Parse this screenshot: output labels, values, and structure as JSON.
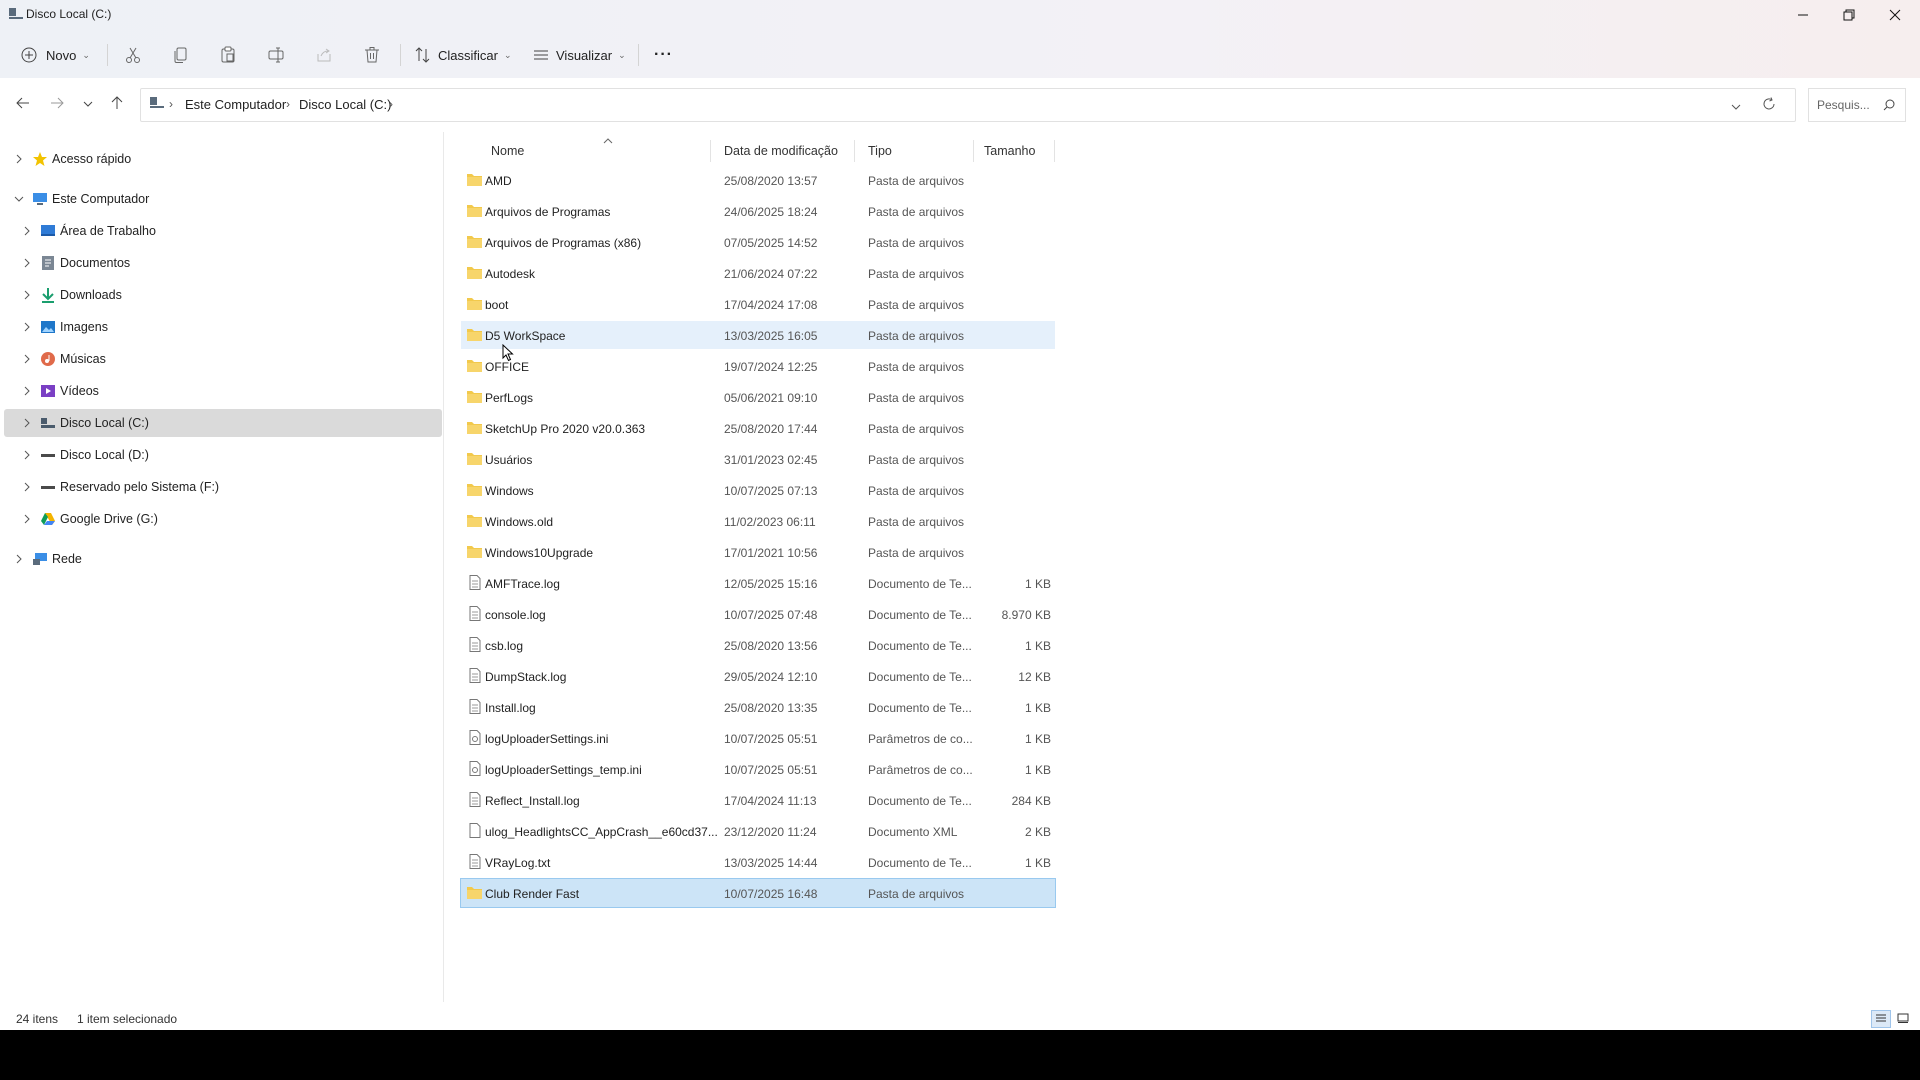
{
  "window": {
    "title": "Disco Local (C:)",
    "minimize": "—",
    "maximize": "❐",
    "close": "✕"
  },
  "toolbar": {
    "new_label": "Novo",
    "sort_label": "Classificar",
    "view_label": "Visualizar",
    "more_label": "···"
  },
  "address": {
    "crumbs": [
      "Este Computador",
      "Disco Local (C:)"
    ],
    "search_placeholder": "Pesquis..."
  },
  "sidebar": {
    "items": [
      {
        "label": "Acesso rápido",
        "icon": "star-icon"
      },
      {
        "label": "Este Computador",
        "icon": "computer-icon"
      },
      {
        "label": "Área de Trabalho",
        "icon": "desktop-icon"
      },
      {
        "label": "Documentos",
        "icon": "documents-icon"
      },
      {
        "label": "Downloads",
        "icon": "download-icon"
      },
      {
        "label": "Imagens",
        "icon": "pictures-icon"
      },
      {
        "label": "Músicas",
        "icon": "music-icon"
      },
      {
        "label": "Vídeos",
        "icon": "videos-icon"
      },
      {
        "label": "Disco Local (C:)",
        "icon": "windows-drive-icon"
      },
      {
        "label": "Disco Local (D:)",
        "icon": "drive-icon"
      },
      {
        "label": "Reservado pelo Sistema (F:)",
        "icon": "drive-icon"
      },
      {
        "label": "Google Drive (G:)",
        "icon": "google-drive-icon"
      },
      {
        "label": "Rede",
        "icon": "network-icon"
      }
    ]
  },
  "columns": {
    "name": "Nome",
    "date": "Data de modificação",
    "type": "Tipo",
    "size": "Tamanho"
  },
  "files": [
    {
      "name": "AMD",
      "date": "25/08/2020 13:57",
      "type": "Pasta de arquivos",
      "size": "",
      "kind": "folder"
    },
    {
      "name": "Arquivos de Programas",
      "date": "24/06/2025 18:24",
      "type": "Pasta de arquivos",
      "size": "",
      "kind": "folder"
    },
    {
      "name": "Arquivos de Programas (x86)",
      "date": "07/05/2025 14:52",
      "type": "Pasta de arquivos",
      "size": "",
      "kind": "folder"
    },
    {
      "name": "Autodesk",
      "date": "21/06/2024 07:22",
      "type": "Pasta de arquivos",
      "size": "",
      "kind": "folder"
    },
    {
      "name": "boot",
      "date": "17/04/2024 17:08",
      "type": "Pasta de arquivos",
      "size": "",
      "kind": "folder"
    },
    {
      "name": "D5 WorkSpace",
      "date": "13/03/2025 16:05",
      "type": "Pasta de arquivos",
      "size": "",
      "kind": "folder"
    },
    {
      "name": "OFFICE",
      "date": "19/07/2024 12:25",
      "type": "Pasta de arquivos",
      "size": "",
      "kind": "folder"
    },
    {
      "name": "PerfLogs",
      "date": "05/06/2021 09:10",
      "type": "Pasta de arquivos",
      "size": "",
      "kind": "folder"
    },
    {
      "name": "SketchUp Pro 2020 v20.0.363",
      "date": "25/08/2020 17:44",
      "type": "Pasta de arquivos",
      "size": "",
      "kind": "folder"
    },
    {
      "name": "Usuários",
      "date": "31/01/2023 02:45",
      "type": "Pasta de arquivos",
      "size": "",
      "kind": "folder"
    },
    {
      "name": "Windows",
      "date": "10/07/2025 07:13",
      "type": "Pasta de arquivos",
      "size": "",
      "kind": "folder"
    },
    {
      "name": "Windows.old",
      "date": "11/02/2023 06:11",
      "type": "Pasta de arquivos",
      "size": "",
      "kind": "folder"
    },
    {
      "name": "Windows10Upgrade",
      "date": "17/01/2021 10:56",
      "type": "Pasta de arquivos",
      "size": "",
      "kind": "folder"
    },
    {
      "name": "AMFTrace.log",
      "date": "12/05/2025 15:16",
      "type": "Documento de Te...",
      "size": "1 KB",
      "kind": "text"
    },
    {
      "name": "console.log",
      "date": "10/07/2025 07:48",
      "type": "Documento de Te...",
      "size": "8.970 KB",
      "kind": "text"
    },
    {
      "name": "csb.log",
      "date": "25/08/2020 13:56",
      "type": "Documento de Te...",
      "size": "1 KB",
      "kind": "text"
    },
    {
      "name": "DumpStack.log",
      "date": "29/05/2024 12:10",
      "type": "Documento de Te...",
      "size": "12 KB",
      "kind": "text"
    },
    {
      "name": "Install.log",
      "date": "25/08/2020 13:35",
      "type": "Documento de Te...",
      "size": "1 KB",
      "kind": "text"
    },
    {
      "name": "logUploaderSettings.ini",
      "date": "10/07/2025 05:51",
      "type": "Parâmetros de co...",
      "size": "1 KB",
      "kind": "ini"
    },
    {
      "name": "logUploaderSettings_temp.ini",
      "date": "10/07/2025 05:51",
      "type": "Parâmetros de co...",
      "size": "1 KB",
      "kind": "ini"
    },
    {
      "name": "Reflect_Install.log",
      "date": "17/04/2024 11:13",
      "type": "Documento de Te...",
      "size": "284 KB",
      "kind": "text"
    },
    {
      "name": "ulog_HeadlightsCC_AppCrash__e60cd37...",
      "date": "23/12/2020 11:24",
      "type": "Documento XML",
      "size": "2 KB",
      "kind": "xml"
    },
    {
      "name": "VRayLog.txt",
      "date": "13/03/2025 14:44",
      "type": "Documento de Te...",
      "size": "1 KB",
      "kind": "text"
    },
    {
      "name": "Club Render Fast",
      "date": "10/07/2025 16:48",
      "type": "Pasta de arquivos",
      "size": "",
      "kind": "folder"
    }
  ],
  "status": {
    "count": "24 itens",
    "selection": "1 item selecionado"
  },
  "colors": {
    "folder": "#f2c94c",
    "accent": "#0067c0",
    "selected_row": "#cce4f7",
    "hover_row": "#e5f0fb"
  }
}
